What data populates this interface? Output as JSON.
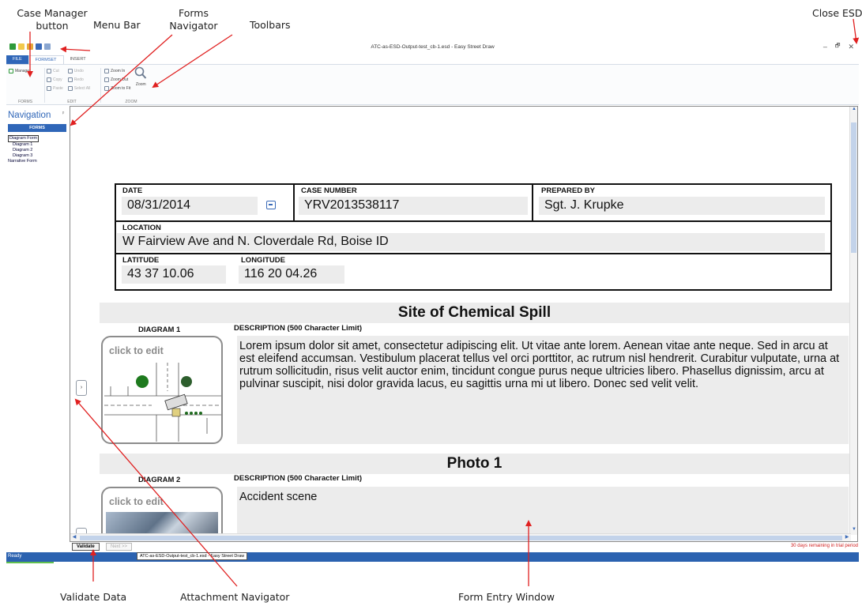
{
  "callouts": {
    "case_manager": "Case Manager\nbutton",
    "menu_bar": "Menu Bar",
    "forms_navigator": "Forms\nNavigator",
    "toolbars": "Toolbars",
    "close_esd": "Close ESD",
    "validate_data": "Validate Data",
    "attachment_navigator": "Attachment Navigator",
    "form_entry_window": "Form Entry Window"
  },
  "window": {
    "title": "ATC-as-ESD-Output-test_cb-1.esd - Easy Street Draw",
    "controls": {
      "minimize": "–",
      "restore": "🗗",
      "close": "✕"
    }
  },
  "ribbon": {
    "tabs": [
      "FILE",
      "FORMSET",
      "INSERT"
    ],
    "forms_group": {
      "manager": "Manager",
      "label": "FORMS"
    },
    "edit_group": {
      "cut": "Cut",
      "copy": "Copy",
      "paste": "Paste",
      "undo": "Undo",
      "redo": "Redo",
      "select_all": "Select All",
      "label": "EDIT"
    },
    "zoom_group": {
      "zoom_in": "Zoom In",
      "zoom_out": "Zoom Out",
      "zoom_fit": "Zoom to Fit",
      "zoom": "Zoom",
      "label": "ZOOM"
    }
  },
  "navigation": {
    "title": "Navigation",
    "pin": "ᵖ",
    "tab": "FORMS",
    "tree": {
      "root": "Diagram Form",
      "children": [
        "Diagram 1",
        "Diagram 2",
        "Diagram 3"
      ],
      "other": "Narrative Form"
    }
  },
  "form": {
    "date_label": "DATE",
    "date_value": "08/31/2014",
    "case_label": "CASE NUMBER",
    "case_value": "YRV2013538117",
    "prepared_label": "PREPARED BY",
    "prepared_value": "Sgt. J. Krupke",
    "location_label": "LOCATION",
    "location_value": "W Fairview Ave and N. Cloverdale Rd, Boise ID",
    "latitude_label": "LATITUDE",
    "latitude_value": "43 37 10.06",
    "longitude_label": "LONGITUDE",
    "longitude_value": "116 20 04.26",
    "section1_title": "Site of Chemical Spill",
    "diagram1_label": "DIAGRAM 1",
    "desc_label": "DESCRIPTION (500 Character Limit)",
    "click_to_edit": "click to edit",
    "desc1": "Lorem ipsum dolor sit amet, consectetur adipiscing elit. Ut vitae ante lorem. Aenean vitae ante neque. Sed in arcu at est eleifend accumsan. Vestibulum placerat tellus vel orci porttitor, ac rutrum nisl hendrerit. Curabitur vulputate, urna at rutrum sollicitudin, risus velit auctor enim, tincidunt congue purus neque ultricies libero. Phasellus dignissim, arcu at pulvinar suscipit, nisi dolor gravida lacus, eu sagittis urna mi ut libero. Donec sed velit velit.",
    "section2_title": "Photo 1",
    "diagram2_label": "DIAGRAM 2",
    "desc2": "Accident scene"
  },
  "bottom": {
    "validate": "Validate",
    "next": "Next >>",
    "trial": "30 days remaining in trial period",
    "status": "Ready",
    "taskbar_tip": "ATC-as-ESD-Output-test_cb-1.esd - Easy Street Draw"
  },
  "colors": {
    "accent": "#2f66b8",
    "arrow": "#e02020",
    "field_bg": "#ececec"
  }
}
